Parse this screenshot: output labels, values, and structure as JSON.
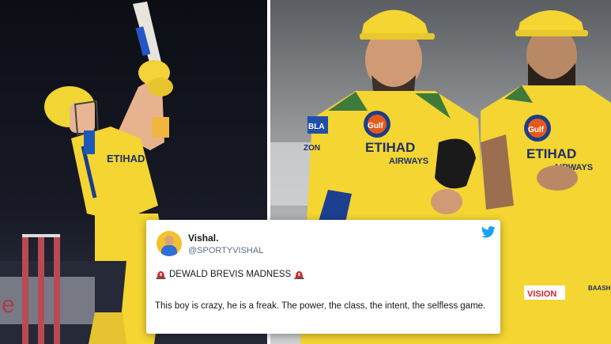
{
  "tweet": {
    "name": "Vishal.",
    "handle": "@SPORTYVISHAL",
    "headline": "DEWALD BREVIS MADNESS",
    "body": "This boy is crazy, he is a freak. The power, the class, the intent, the selfless game."
  },
  "icons": {
    "platform": "twitter-bird-icon",
    "headline_emoji": "siren-emoji"
  },
  "colors": {
    "twitter_blue": "#1da1f2",
    "jersey_yellow": "#f4d531",
    "siren_red": "#d8232a"
  }
}
